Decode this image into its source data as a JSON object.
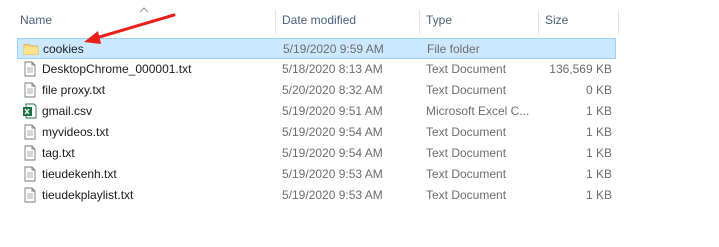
{
  "columns": {
    "name": "Name",
    "date": "Date modified",
    "type": "Type",
    "size": "Size"
  },
  "files": [
    {
      "name": "cookies",
      "date": "5/19/2020 9:59 AM",
      "type": "File folder",
      "size": "",
      "icon": "folder-icon",
      "selected": true
    },
    {
      "name": "DesktopChrome_000001.txt",
      "date": "5/18/2020 8:13 AM",
      "type": "Text Document",
      "size": "136,569 KB",
      "icon": "text-file-icon",
      "selected": false
    },
    {
      "name": "file proxy.txt",
      "date": "5/20/2020 8:32 AM",
      "type": "Text Document",
      "size": "0 KB",
      "icon": "text-file-icon",
      "selected": false
    },
    {
      "name": "gmail.csv",
      "date": "5/19/2020 9:51 AM",
      "type": "Microsoft Excel C...",
      "size": "1 KB",
      "icon": "excel-csv-icon",
      "selected": false
    },
    {
      "name": "myvideos.txt",
      "date": "5/19/2020 9:54 AM",
      "type": "Text Document",
      "size": "1 KB",
      "icon": "text-file-icon",
      "selected": false
    },
    {
      "name": "tag.txt",
      "date": "5/19/2020 9:54 AM",
      "type": "Text Document",
      "size": "1 KB",
      "icon": "text-file-icon",
      "selected": false
    },
    {
      "name": "tieudekenh.txt",
      "date": "5/19/2020 9:53 AM",
      "type": "Text Document",
      "size": "1 KB",
      "icon": "text-file-icon",
      "selected": false
    },
    {
      "name": "tieudekplaylist.txt",
      "date": "5/19/2020 9:53 AM",
      "type": "Text Document",
      "size": "1 KB",
      "icon": "text-file-icon",
      "selected": false
    }
  ],
  "colors": {
    "selection_bg": "#cce8ff",
    "selection_border": "#99d1ff",
    "header_text": "#4c607a",
    "annotation_arrow": "#e8201c"
  }
}
